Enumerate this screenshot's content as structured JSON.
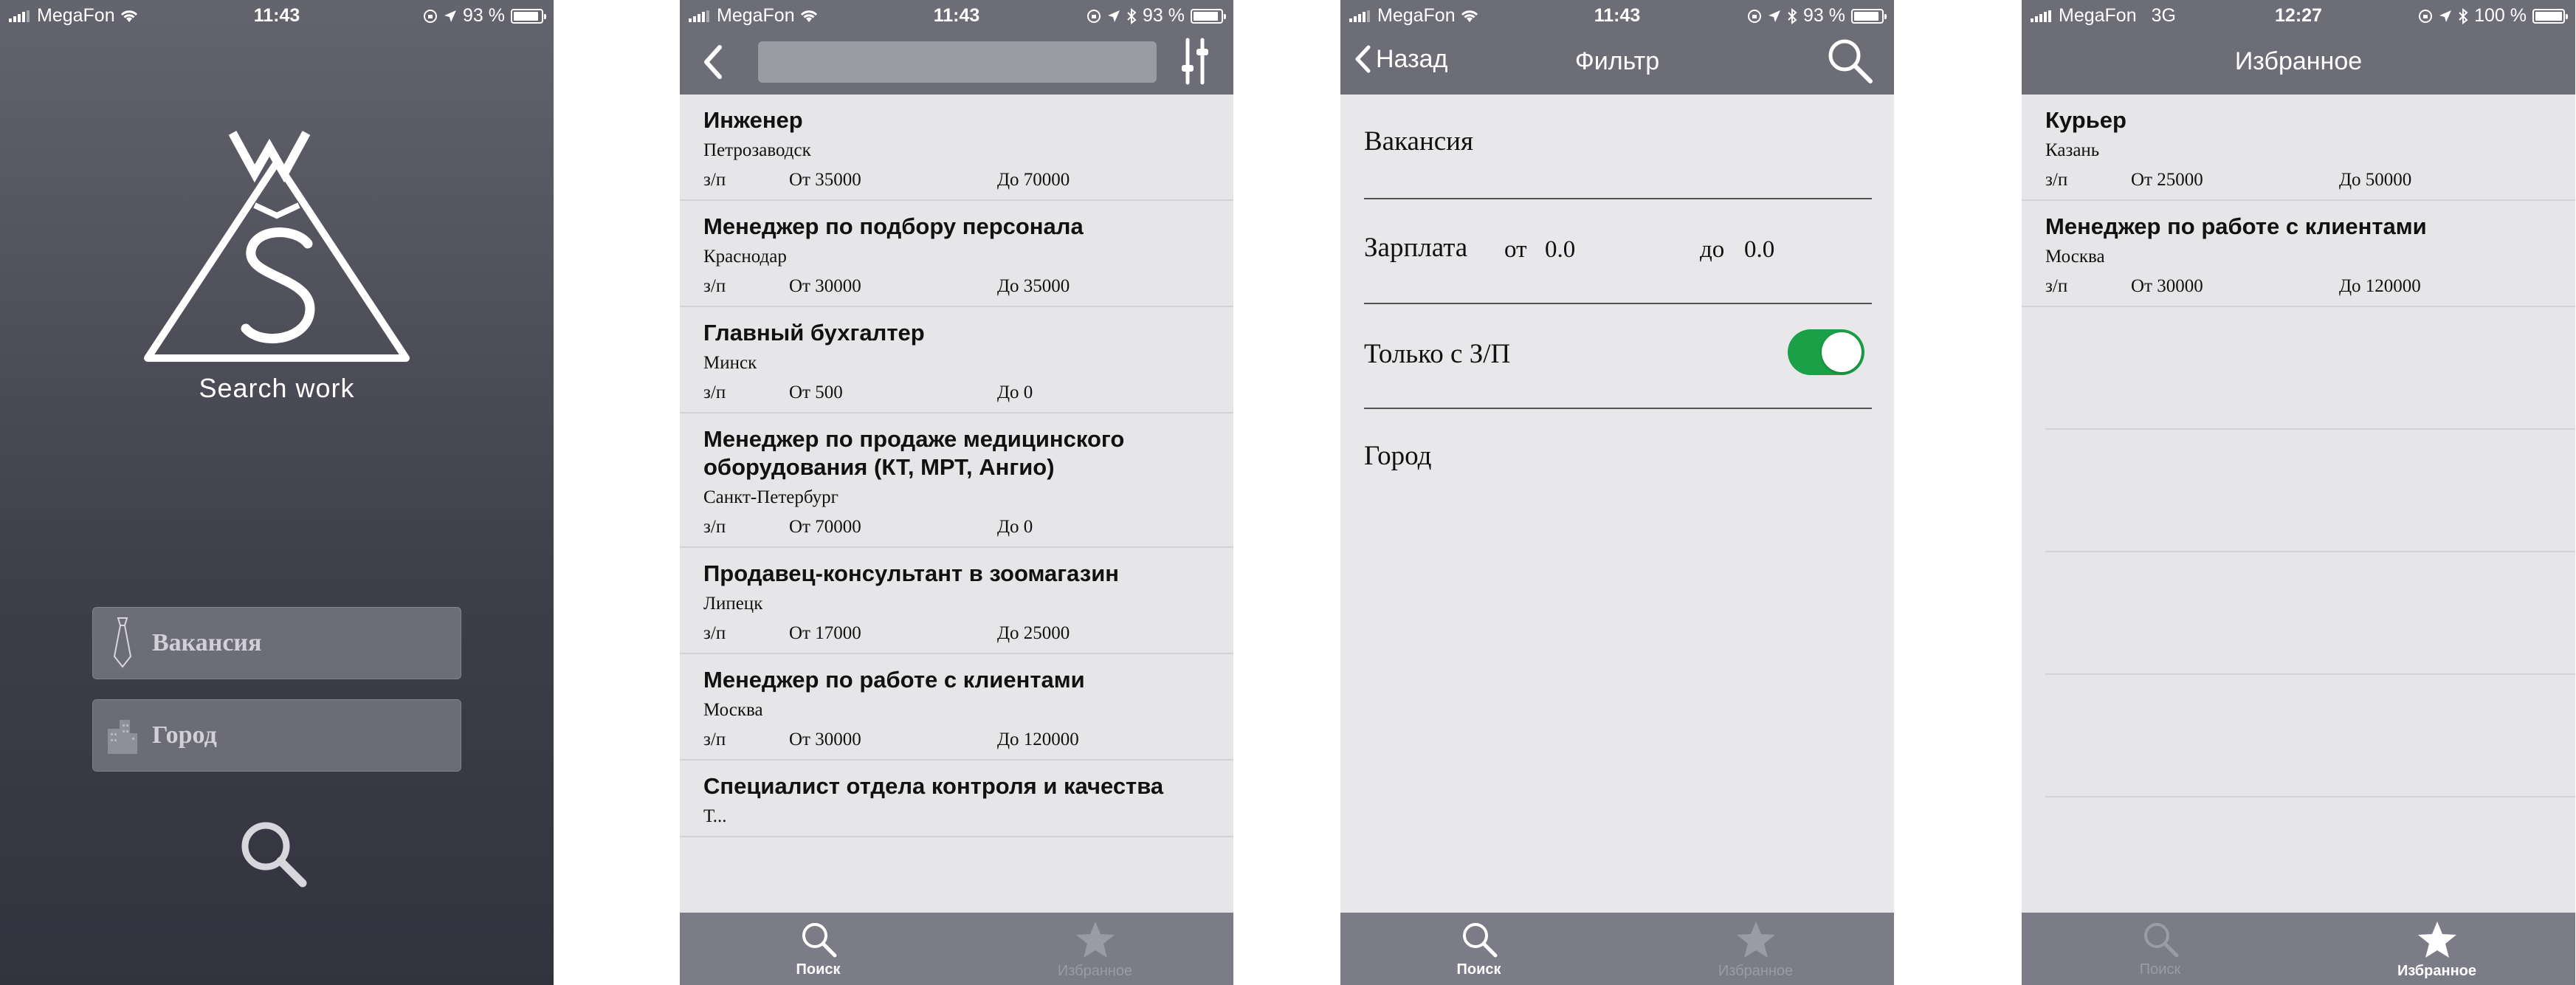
{
  "colors": {
    "navbar": "#6d6d78",
    "tabbar": "#7c7c88",
    "toggle_on": "#1aa046",
    "list_bg": "#e6e6e8"
  },
  "screens": [
    {
      "status": {
        "carrier": "MegaFon",
        "network": "",
        "time": "11:43",
        "battery": "93 %"
      },
      "brand": "Search work",
      "vacancy_placeholder": "Вакансия",
      "city_placeholder": "Город",
      "icons": {
        "vacancy": "tie-icon",
        "city": "buildings-icon",
        "search": "search-icon"
      }
    },
    {
      "status": {
        "carrier": "MegaFon",
        "network": "",
        "time": "11:43",
        "battery": "93 %"
      },
      "search_value": "",
      "salary_label": "з/п",
      "jobs": [
        {
          "title": "Инженер",
          "city": "Петрозаводск",
          "from": "От 35000",
          "to": "До 70000"
        },
        {
          "title": "Менеджер по подбору персонала",
          "city": "Краснодар",
          "from": "От 30000",
          "to": "До 35000"
        },
        {
          "title": "Главный бухгалтер",
          "city": "Минск",
          "from": "От 500",
          "to": "До 0"
        },
        {
          "title": "Менеджер по продаже медицинского оборудования (КТ, МРТ, Ангио)",
          "city": "Санкт-Петербург",
          "from": "От 70000",
          "to": "До 0"
        },
        {
          "title": "Продавец-консультант в зоомагазин",
          "city": "Липецк",
          "from": "От 17000",
          "to": "До 25000"
        },
        {
          "title": "Менеджер по работе с клиентами",
          "city": "Москва",
          "from": "От 30000",
          "to": "До 120000"
        },
        {
          "title": "Специалист отдела контроля и качества",
          "city": "Т...",
          "from": "",
          "to": ""
        }
      ],
      "tabs": [
        {
          "label": "Поиск",
          "icon": "search-icon",
          "active": true
        },
        {
          "label": "Избранное",
          "icon": "star-icon",
          "active": false
        }
      ]
    },
    {
      "status": {
        "carrier": "MegaFon",
        "network": "",
        "time": "11:43",
        "battery": "93 %"
      },
      "back_label": "Назад",
      "title": "Фильтр",
      "vacancy_label": "Вакансия",
      "salary_label": "Зарплата",
      "from_label": "от",
      "from_value": "0.0",
      "to_label": "до",
      "to_value": "0.0",
      "only_salary_label": "Только с З/П",
      "only_salary_on": true,
      "city_label": "Город",
      "tabs": [
        {
          "label": "Поиск",
          "icon": "search-icon",
          "active": true
        },
        {
          "label": "Избранное",
          "icon": "star-icon",
          "active": false
        }
      ]
    },
    {
      "status": {
        "carrier": "MegaFon",
        "network": "3G",
        "time": "12:27",
        "battery": "100 %"
      },
      "title": "Избранное",
      "salary_label": "з/п",
      "jobs": [
        {
          "title": "Курьер",
          "city": "Казань",
          "from": "От 25000",
          "to": "До 50000"
        },
        {
          "title": "Менеджер по работе с клиентами",
          "city": "Москва",
          "from": "От 30000",
          "to": "До 120000"
        }
      ],
      "tabs": [
        {
          "label": "Поиск",
          "icon": "search-icon",
          "active": false
        },
        {
          "label": "Избранное",
          "icon": "star-icon",
          "active": true
        }
      ]
    }
  ]
}
